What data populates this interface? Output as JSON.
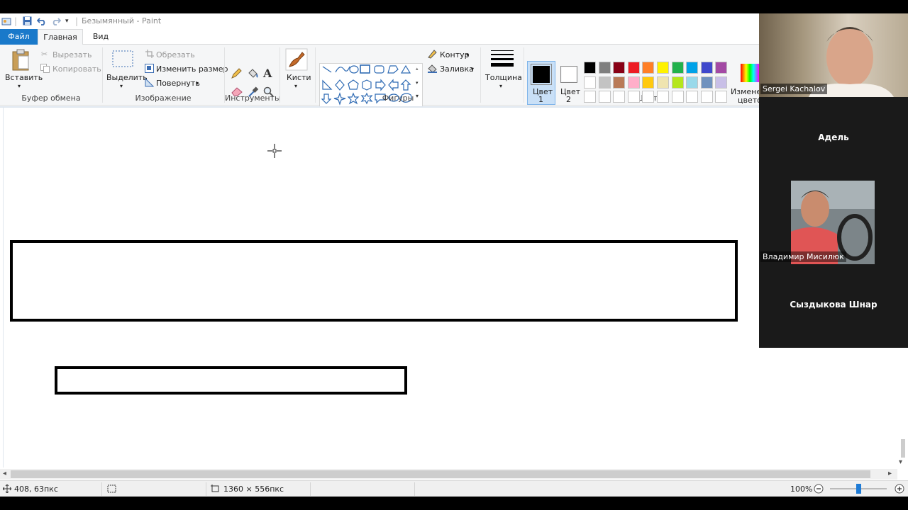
{
  "titlebar": {
    "title": "Безымянный - Paint"
  },
  "tabs": {
    "file": "Файл",
    "home": "Главная",
    "view": "Вид"
  },
  "clipboard": {
    "paste": "Вставить",
    "cut": "Вырезать",
    "copy": "Копировать",
    "group": "Буфер обмена"
  },
  "image": {
    "select": "Выделить",
    "crop": "Обрезать",
    "resize": "Изменить размер",
    "rotate": "Повернуть",
    "group": "Изображение"
  },
  "tools": {
    "group": "Инструменты"
  },
  "brushes": {
    "label": "Кисти"
  },
  "shapes": {
    "outline": "Контур",
    "fill": "Заливка",
    "group": "Фигуры"
  },
  "size": {
    "label": "Толщина"
  },
  "colors": {
    "color1_label": "Цвет",
    "color1_num": "1",
    "color2_label": "Цвет",
    "color2_num": "2",
    "edit_label_1": "Изменен",
    "edit_label_2": "цвето",
    "group": "Цвета",
    "color1_value": "#000000",
    "color2_value": "#ffffff",
    "palette_row1": [
      "#000000",
      "#7f7f7f",
      "#880015",
      "#ed1c24",
      "#ff7f27",
      "#fff200",
      "#22b14c",
      "#00a2e8",
      "#3f48cc",
      "#a349a4"
    ],
    "palette_row2": [
      "#ffffff",
      "#c3c3c3",
      "#b97a57",
      "#ffaec9",
      "#ffc90e",
      "#efe4b0",
      "#b5e61d",
      "#99d9ea",
      "#7092be",
      "#c8bfe7"
    ],
    "palette_row3": [
      "#ffffff",
      "#ffffff",
      "#ffffff",
      "#ffffff",
      "#ffffff",
      "#ffffff",
      "#ffffff",
      "#ffffff",
      "#ffffff",
      "#ffffff"
    ]
  },
  "status": {
    "cursor_pos": "408, 63пкс",
    "canvas_size": "1360 × 556пкс",
    "zoom": "100%",
    "zoom_fraction": 0.5
  },
  "video": {
    "p1": "Sergei Kachalov",
    "p2": "Адель",
    "p3": "Владимир Мисилюк",
    "p4": "Сыздыкова Шнар"
  }
}
